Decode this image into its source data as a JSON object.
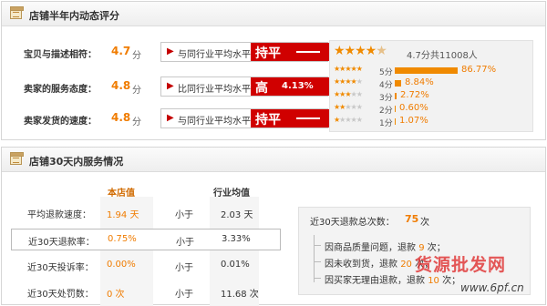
{
  "dsr_panel": {
    "title": "店铺半年内动态评分",
    "ratings": [
      {
        "label": "宝贝与描述相符：",
        "score": "4.7",
        "unit": "分",
        "compare_text": "与同行业平均水平",
        "badge_word": "持平",
        "badge_pct": ""
      },
      {
        "label": "卖家的服务态度：",
        "score": "4.8",
        "unit": "分",
        "compare_text": "比同行业平均水平",
        "badge_word": "高",
        "badge_pct": "4.13%"
      },
      {
        "label": "卖家发货的速度：",
        "score": "4.8",
        "unit": "分",
        "compare_text": "与同行业平均水平",
        "badge_word": "持平",
        "badge_pct": ""
      }
    ],
    "distribution": {
      "average": "4.7分",
      "total": "共11008人",
      "rows": [
        {
          "stars": 5,
          "label": "5分",
          "pct": "86.77%",
          "fraction": 0.8677
        },
        {
          "stars": 4,
          "label": "4分",
          "pct": "8.84%",
          "fraction": 0.0884
        },
        {
          "stars": 3,
          "label": "3分",
          "pct": "2.72%",
          "fraction": 0.0272
        },
        {
          "stars": 2,
          "label": "2分",
          "pct": "0.60%",
          "fraction": 0.006
        },
        {
          "stars": 1,
          "label": "1分",
          "pct": "1.07%",
          "fraction": 0.0107
        }
      ]
    },
    "accent_color": "#f07c00",
    "badge_color": "#d00000"
  },
  "service_panel": {
    "title": "店铺30天内服务情况",
    "col_store": "本店值",
    "col_avg": "行业均值",
    "rows": [
      {
        "label": "平均退款速度：",
        "store": "1.94 天",
        "compare": "小于",
        "avg": "2.03 天"
      },
      {
        "label": "近30天退款率：",
        "store": "0.75%",
        "compare": "小于",
        "avg": "3.33%"
      },
      {
        "label": "近30天投诉率：",
        "store": "0.00%",
        "compare": "小于",
        "avg": "0.01%"
      },
      {
        "label": "近30天处罚数：",
        "store": "0 次",
        "compare": "小于",
        "avg": "11.68 次"
      }
    ],
    "refund": {
      "title": "近30天退款总次数：",
      "count": "75",
      "count_unit": "次",
      "items": [
        {
          "prefix": "因商品质量问题，退款",
          "num": "9",
          "suffix": "次；"
        },
        {
          "prefix": "因未收到货，退款",
          "num": "20",
          "suffix": "次；"
        },
        {
          "prefix": "因买家无理由退款，退款",
          "num": "10",
          "suffix": "次；"
        }
      ]
    }
  },
  "watermark": {
    "text": "货源批发网",
    "url": "www.6pf.cn"
  }
}
